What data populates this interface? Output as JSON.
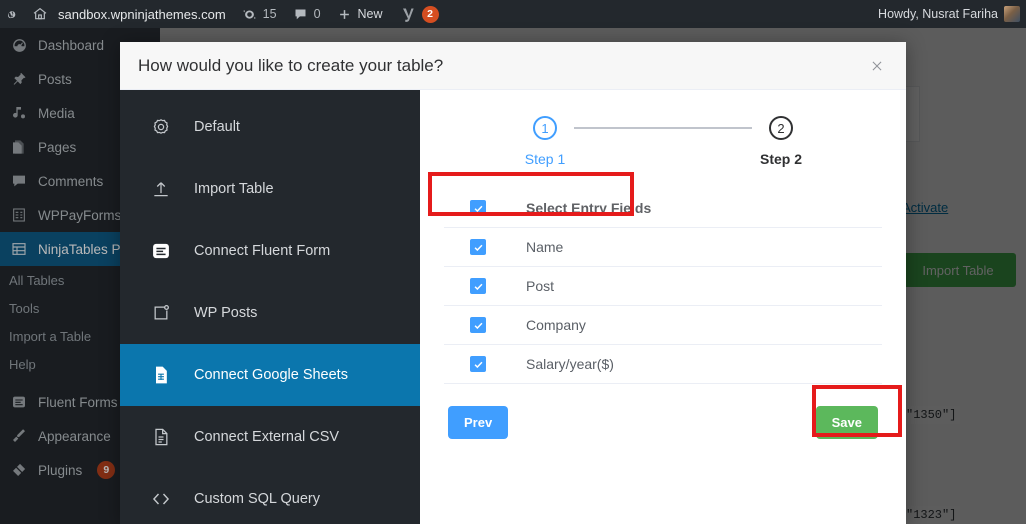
{
  "adminbar": {
    "logo_icon": "wordpress-icon",
    "home_icon": "home-icon",
    "site_name": "sandbox.wpninjathemes.com",
    "updates_icon": "updates-icon",
    "updates_count": "15",
    "comments_icon": "comments-icon",
    "comments_count": "0",
    "new_icon": "plus-icon",
    "new_label": "New",
    "yoast_icon": "yoast-icon",
    "yoast_count": "2",
    "howdy": "Howdy, Nusrat Fariha",
    "avatar": "avatar"
  },
  "wpmenu": {
    "items": [
      {
        "label": "Dashboard",
        "icon": "dashboard-icon",
        "active": false
      },
      {
        "label": "Posts",
        "icon": "pin-icon",
        "active": false
      },
      {
        "label": "Media",
        "icon": "media-icon",
        "active": false
      },
      {
        "label": "Pages",
        "icon": "pages-icon",
        "active": false
      },
      {
        "label": "Comments",
        "icon": "comment-icon",
        "active": false
      },
      {
        "label": "WPPayForms Pro",
        "icon": "form-icon",
        "active": false
      },
      {
        "label": "NinjaTables Pro",
        "icon": "table-icon",
        "active": true
      }
    ],
    "submenu": [
      "All Tables",
      "Tools",
      "Import a Table",
      "Help"
    ],
    "items2": [
      {
        "label": "Fluent Forms Pro",
        "icon": "fluentforms-icon"
      },
      {
        "label": "Appearance",
        "icon": "appearance-icon"
      },
      {
        "label": "Plugins",
        "icon": "plugins-icon",
        "badge": "9"
      }
    ]
  },
  "background": {
    "activate_link": "Activate",
    "import_table_button": "Import Table",
    "code_1": "\"1350\"]",
    "code_2": "\"1323\"]"
  },
  "modal": {
    "title": "How would you like to create your table?",
    "close_icon": "close-icon",
    "sidebar": [
      {
        "label": "Default",
        "icon": "gear-icon",
        "selected": false
      },
      {
        "label": "Import Table",
        "icon": "upload-icon",
        "selected": false
      },
      {
        "label": "Connect Fluent Form",
        "icon": "fluent-form-icon",
        "selected": false
      },
      {
        "label": "WP Posts",
        "icon": "wp-posts-icon",
        "selected": false
      },
      {
        "label": "Connect Google Sheets",
        "icon": "google-sheets-icon",
        "selected": true
      },
      {
        "label": "Connect External CSV",
        "icon": "csv-file-icon",
        "selected": false
      },
      {
        "label": "Custom SQL Query",
        "icon": "code-icon",
        "selected": false
      }
    ],
    "steps": [
      {
        "number": "1",
        "label": "Step 1",
        "state": "active"
      },
      {
        "number": "2",
        "label": "Step 2",
        "state": "done"
      }
    ],
    "fields_header": {
      "label": "Select Entry Fields",
      "checked": true
    },
    "fields": [
      {
        "label": "Name",
        "checked": true
      },
      {
        "label": "Post",
        "checked": true
      },
      {
        "label": "Company",
        "checked": true
      },
      {
        "label": "Salary/year($)",
        "checked": true
      }
    ],
    "buttons": {
      "prev": "Prev",
      "save": "Save"
    }
  },
  "colors": {
    "accent_blue": "#409eff",
    "selected_nav": "#0b76ad",
    "save_green": "#5cb85c",
    "highlight_red": "#e51b1b",
    "admin_dark": "#23282d"
  }
}
